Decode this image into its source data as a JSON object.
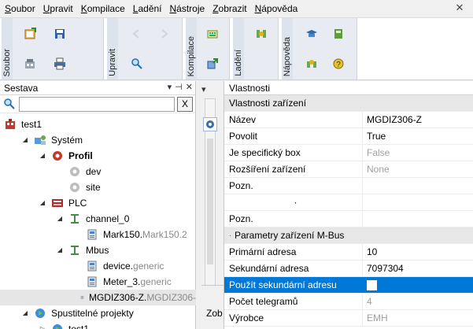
{
  "menu": {
    "items": [
      "Soubor",
      "Upravit",
      "Kompilace",
      "Ladění",
      "Nástroje",
      "Zobrazit",
      "Nápověda"
    ],
    "underline": [
      "S",
      "U",
      "K",
      "L",
      "N",
      "Z",
      "N"
    ],
    "close_glyph": "✕"
  },
  "toolbar": {
    "groups": [
      "Soubor",
      "Upravit",
      "Kompilace",
      "Ladění",
      "Nápověda"
    ]
  },
  "left_panel": {
    "title": "Sestava",
    "header_buttons": [
      "▾",
      "⊣",
      "✕"
    ],
    "search_placeholder": "",
    "search_clear": "X",
    "tree": [
      {
        "label": "test1",
        "type": "",
        "indent": 0,
        "expander": "",
        "icon": "project-icon",
        "bold": false
      },
      {
        "label": "Systém",
        "type": "",
        "indent": 1,
        "expander": "◢",
        "icon": "system-icon",
        "bold": false
      },
      {
        "label": "Profil",
        "type": "",
        "indent": 2,
        "expander": "◢",
        "icon": "profile-gear-icon",
        "bold": true
      },
      {
        "label": "dev",
        "type": "",
        "indent": 3,
        "expander": "",
        "icon": "gear-icon",
        "bold": false
      },
      {
        "label": "site",
        "type": "",
        "indent": 3,
        "expander": "",
        "icon": "gear-icon",
        "bold": false
      },
      {
        "label": "PLC",
        "type": "",
        "indent": 2,
        "expander": "◢",
        "icon": "plc-icon",
        "bold": false
      },
      {
        "label": "channel_0",
        "type": "",
        "indent": 3,
        "expander": "◢",
        "icon": "channel-icon",
        "bold": false
      },
      {
        "label": "Mark150.",
        "type": "Mark150.2",
        "indent": 4,
        "expander": "",
        "icon": "device-icon",
        "bold": false
      },
      {
        "label": "Mbus",
        "type": "",
        "indent": 3,
        "expander": "◢",
        "icon": "channel-icon",
        "bold": false
      },
      {
        "label": "device.",
        "type": "generic",
        "indent": 4,
        "expander": "",
        "icon": "device-icon",
        "bold": false
      },
      {
        "label": "Meter_3.",
        "type": "generic",
        "indent": 4,
        "expander": "",
        "icon": "device-icon",
        "bold": false
      },
      {
        "label": "MGDIZ306-Z.",
        "type": "MGDIZ306-",
        "indent": 4,
        "expander": "",
        "icon": "device-icon",
        "bold": false,
        "selected": true
      },
      {
        "label": "Spustitelné projekty",
        "type": "",
        "indent": 1,
        "expander": "◢",
        "icon": "executable-icon",
        "bold": false
      },
      {
        "label": "test1",
        "type": "",
        "indent": 2,
        "expander": "▷",
        "icon": "executable-icon",
        "bold": false
      }
    ]
  },
  "bottom_tab": {
    "label": "Zob"
  },
  "right_panel": {
    "title": "Vlastnosti",
    "rows": [
      {
        "kind": "category",
        "name": "Vlastnosti zařízení",
        "value": ""
      },
      {
        "kind": "prop",
        "name": "Název",
        "value": "MGDIZ306-Z",
        "dim": false
      },
      {
        "kind": "prop",
        "name": "Povolit",
        "value": "True",
        "dim": false
      },
      {
        "kind": "prop",
        "name": "Je specifický box",
        "value": "False",
        "dim": true
      },
      {
        "kind": "prop",
        "name": "Rozšíření zařízení",
        "value": "None",
        "dim": true
      },
      {
        "kind": "prop",
        "name": "Pozn.",
        "value": "",
        "dim": false
      },
      {
        "kind": "prop",
        "name": "·",
        "value": "",
        "dim": false
      },
      {
        "kind": "prop",
        "name": "Pozn.",
        "value": "",
        "dim": false
      },
      {
        "kind": "category",
        "name": "Parametry zařízení M-Bus",
        "value": "",
        "dot": "·"
      },
      {
        "kind": "prop",
        "name": "Primární adresa",
        "value": "10",
        "dim": false
      },
      {
        "kind": "prop",
        "name": "Sekundární adresa",
        "value": "7097304",
        "dim": false
      },
      {
        "kind": "prop",
        "name": "Použít sekundární adresu",
        "value": "",
        "dim": false,
        "selected": true,
        "checkbox": true
      },
      {
        "kind": "prop",
        "name": "Počet telegramů",
        "value": "4",
        "dim": true
      },
      {
        "kind": "prop",
        "name": "Výrobce",
        "value": "EMH",
        "dim": true
      }
    ]
  },
  "colors": {
    "selection": "#0078d7",
    "category_bg": "#e7e7e7",
    "toolbar_bg": "#e8ecf2"
  }
}
